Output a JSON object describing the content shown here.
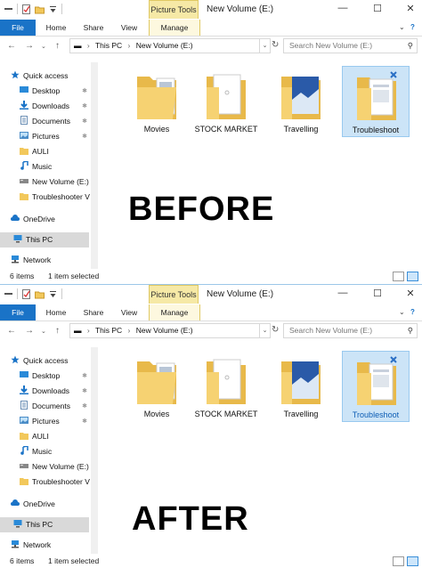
{
  "windows": [
    {
      "id": "before",
      "context_tab": "Picture Tools",
      "title": "New Volume (E:)",
      "window_controls": {
        "minimize": "—",
        "maximize": "☐",
        "close": "✕"
      },
      "ribbon_tabs": {
        "file": "File",
        "home": "Home",
        "share": "Share",
        "view": "View",
        "manage": "Manage"
      },
      "breadcrumb": {
        "root": "This PC",
        "current": "New Volume (E:)"
      },
      "search_placeholder": "Search New Volume (E:)",
      "nav": {
        "quick_access": "Quick access",
        "desktop": "Desktop",
        "downloads": "Downloads",
        "documents": "Documents",
        "pictures": "Pictures",
        "auli": "AULI",
        "music": "Music",
        "new_volume": "New Volume (E:)",
        "troubleshooter": "Troubleshooter V",
        "onedrive": "OneDrive",
        "this_pc": "This PC",
        "network": "Network"
      },
      "items": [
        {
          "label": "Movies"
        },
        {
          "label": "STOCK MARKET"
        },
        {
          "label": "Travelling"
        },
        {
          "label": "Troubleshoot"
        }
      ],
      "caption": "BEFORE",
      "status": {
        "count": "6 items",
        "selection": "1 item selected"
      }
    },
    {
      "id": "after",
      "context_tab": "Picture Tools",
      "title": "New Volume (E:)",
      "window_controls": {
        "minimize": "—",
        "maximize": "☐",
        "close": "✕"
      },
      "ribbon_tabs": {
        "file": "File",
        "home": "Home",
        "share": "Share",
        "view": "View",
        "manage": "Manage"
      },
      "breadcrumb": {
        "root": "This PC",
        "current": "New Volume (E:)"
      },
      "search_placeholder": "Search New Volume (E:)",
      "nav": {
        "quick_access": "Quick access",
        "desktop": "Desktop",
        "downloads": "Downloads",
        "documents": "Documents",
        "pictures": "Pictures",
        "auli": "AULI",
        "music": "Music",
        "new_volume": "New Volume (E:)",
        "troubleshooter": "Troubleshooter V",
        "onedrive": "OneDrive",
        "this_pc": "This PC",
        "network": "Network"
      },
      "items": [
        {
          "label": "Movies"
        },
        {
          "label": "STOCK MARKET"
        },
        {
          "label": "Travelling"
        },
        {
          "label": "Troubleshoot"
        }
      ],
      "caption": "AFTER",
      "status": {
        "count": "6 items",
        "selection": "1 item selected"
      }
    }
  ],
  "colors": {
    "accent": "#1a73c7",
    "context_tab": "#f6e9a6",
    "selection": "#cce4f7",
    "folder": "#f2c85b"
  }
}
